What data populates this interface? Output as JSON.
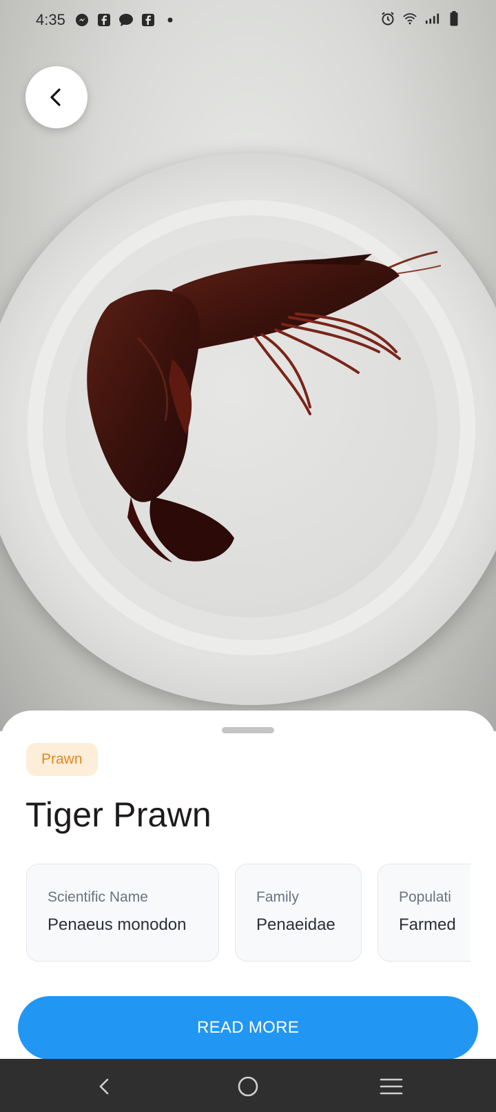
{
  "status_bar": {
    "time": "4:35",
    "left_icons": [
      "messenger-icon",
      "facebook-icon",
      "chat-bubble-icon",
      "facebook-icon",
      "dot-icon"
    ],
    "right_icons": [
      "alarm-icon",
      "wifi-icon",
      "signal-icon",
      "battery-icon"
    ]
  },
  "sheet": {
    "tag": "Prawn",
    "title": "Tiger Prawn",
    "info_cards": [
      {
        "label": "Scientific Name",
        "value": "Penaeus monodon"
      },
      {
        "label": "Family",
        "value": "Penaeidae"
      },
      {
        "label": "Populati",
        "value": "Farmed"
      }
    ],
    "read_more_label": "READ MORE"
  },
  "colors": {
    "accent": "#2196f3",
    "tag_bg": "#fdeed9",
    "tag_text": "#e08a1e",
    "title_text": "#1d1a1a",
    "navbar_bg": "#2f2f2f"
  },
  "nav_icons": [
    "back-nav-icon",
    "home-nav-icon",
    "recents-nav-icon"
  ]
}
